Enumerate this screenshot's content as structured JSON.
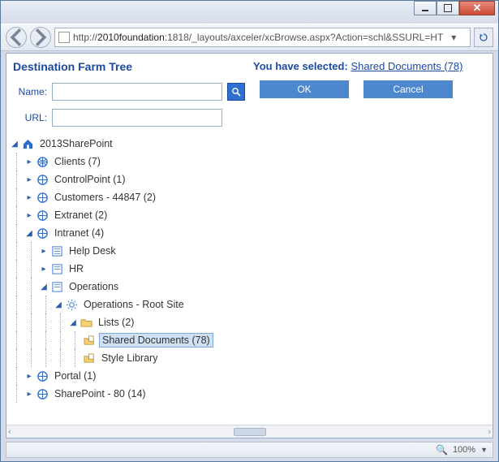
{
  "window": {
    "url_prefix": "http://",
    "url_host": "2010foundation",
    "url_rest": ":1818/_layouts/axceler/xcBrowse.aspx?Action=schl&SSURL=HT"
  },
  "leftPanel": {
    "title": "Destination Farm Tree",
    "nameLabel": "Name:",
    "urlLabel": "URL:",
    "nameValue": "",
    "urlValue": ""
  },
  "tree": {
    "root": "2013SharePoint",
    "clients": "Clients (7)",
    "controlpoint": "ControlPoint (1)",
    "customers": "Customers - 44847 (2)",
    "extranet": "Extranet (2)",
    "intranet": "Intranet (4)",
    "helpdesk": "Help Desk",
    "hr": "HR",
    "operations": "Operations",
    "opsroot": "Operations - Root Site",
    "lists": "Lists (2)",
    "shareddocs": "Shared Documents (78)",
    "stylelib": "Style Library",
    "portal": "Portal (1)",
    "sharepoint80": "SharePoint - 80 (14)"
  },
  "rightPanel": {
    "selectedPrefix": "You have selected:",
    "selectedLink": "Shared Documents (78)",
    "okLabel": "OK",
    "cancelLabel": "Cancel"
  },
  "status": {
    "zoom": "100%"
  }
}
